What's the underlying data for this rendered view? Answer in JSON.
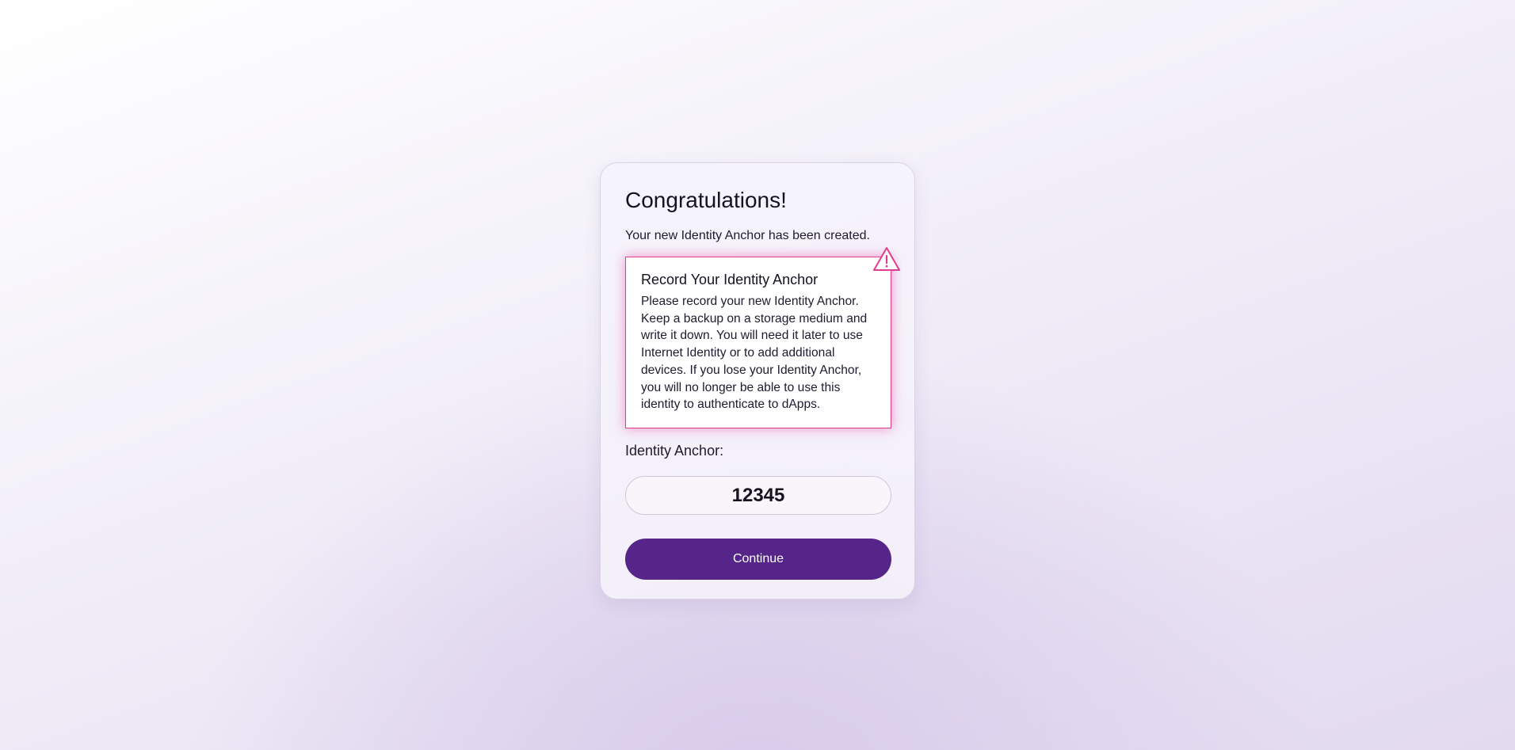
{
  "card": {
    "title": "Congratulations!",
    "subtitle": "Your new Identity Anchor has been created."
  },
  "warning": {
    "icon": "warning-triangle-icon",
    "title": "Record Your Identity Anchor",
    "text": "Please record your new Identity Anchor. Keep a backup on a storage medium and write it down. You will need it later to use Internet Identity or to add additional devices. If you lose your Identity Anchor, you will no longer be able to use this identity to authenticate to dApps.",
    "accent_color": "#e23d8c"
  },
  "anchor": {
    "label": "Identity Anchor:",
    "value": "12345"
  },
  "actions": {
    "continue_label": "Continue",
    "button_color": "#55258a"
  }
}
